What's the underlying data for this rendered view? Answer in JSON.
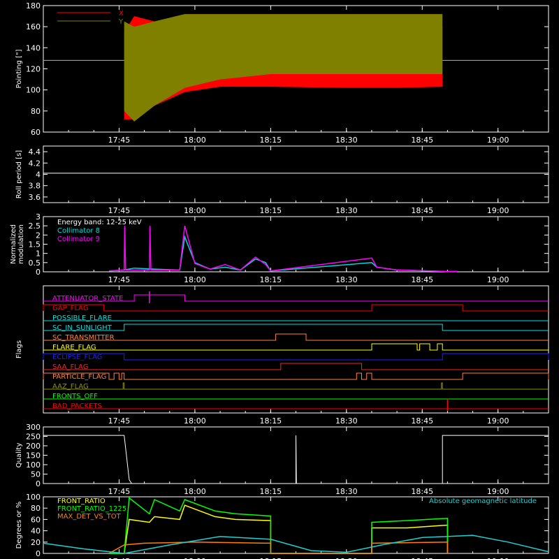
{
  "chart_data": [
    {
      "id": "pointing",
      "type": "area",
      "ylabel": "Pointing [\"]",
      "ylim": [
        60,
        180
      ],
      "yticks": [
        60,
        80,
        100,
        120,
        140,
        160,
        180
      ],
      "xlim": [
        "17:30",
        "19:10"
      ],
      "xticks": [
        "17:45",
        "18:00",
        "18:15",
        "18:30",
        "18:45",
        "19:00"
      ],
      "reference_line": 128,
      "legend": "top-left",
      "series": [
        {
          "name": "X",
          "color": "#ff0000",
          "x": [
            "17:46",
            "17:48",
            "17:52",
            "17:58",
            "18:05",
            "18:15",
            "18:30",
            "18:40",
            "18:49"
          ],
          "upper": [
            155,
            170,
            165,
            168,
            166,
            163,
            160,
            160,
            160
          ],
          "lower": [
            72,
            72,
            85,
            98,
            103,
            103,
            102,
            102,
            103
          ]
        },
        {
          "name": "Y",
          "color": "#808000",
          "x": [
            "17:46",
            "17:48",
            "17:52",
            "17:58",
            "18:05",
            "18:15",
            "18:30",
            "18:40",
            "18:49"
          ],
          "upper": [
            165,
            160,
            165,
            172,
            172,
            172,
            172,
            172,
            172
          ],
          "lower": [
            80,
            70,
            85,
            102,
            110,
            115,
            115,
            115,
            115
          ]
        }
      ]
    },
    {
      "id": "roll",
      "type": "line",
      "ylabel": "Roll period [s]",
      "ylim": [
        3.5,
        4.5
      ],
      "yticks": [
        3.6,
        3.8,
        4.0,
        4.2,
        4.4
      ],
      "xlim": [
        "17:30",
        "19:10"
      ],
      "xticks": [
        "17:45",
        "18:00",
        "18:15",
        "18:30",
        "18:45",
        "19:00"
      ],
      "series": [
        {
          "color": "#ffffff",
          "x": [
            "17:30",
            "19:10"
          ],
          "y": [
            4.02,
            4.02
          ]
        }
      ]
    },
    {
      "id": "modulation",
      "type": "line",
      "ylabel": "Normalized modulation",
      "ylim": [
        0.0,
        3.0
      ],
      "yticks": [
        0.0,
        0.5,
        1.0,
        1.5,
        2.0,
        2.5,
        3.0
      ],
      "xlim": [
        "17:30",
        "19:10"
      ],
      "xticks": [
        "17:45",
        "18:00",
        "18:15",
        "18:30",
        "18:45",
        "19:00"
      ],
      "annotation": "Energy band: 12-25 keV",
      "series": [
        {
          "name": "Collimator 8",
          "color": "#00d8d8",
          "x": [
            "17:43",
            "17:46",
            "17:48",
            "17:52",
            "17:57",
            "17:58",
            "18:00",
            "18:03",
            "18:06",
            "18:09",
            "18:12",
            "18:14",
            "18:15",
            "18:35",
            "18:36",
            "18:40",
            "18:50",
            "18:52"
          ],
          "y": [
            0.05,
            0.1,
            0.2,
            0.15,
            0.1,
            1.9,
            0.5,
            0.15,
            0.25,
            0.1,
            0.7,
            0.5,
            0.05,
            0.5,
            0.25,
            0.1,
            0.02,
            0.02
          ]
        },
        {
          "name": "Collimator 9",
          "color": "#ff00ff",
          "x": [
            "17:43",
            "17:46",
            "17:46.1",
            "17:46.3",
            "17:48",
            "17:50",
            "17:51",
            "17:51.1",
            "17:51.3",
            "17:52",
            "17:57",
            "17:58",
            "18:00",
            "18:03",
            "18:06",
            "18:09",
            "18:12",
            "18:14",
            "18:15",
            "18:35",
            "18:36",
            "18:40",
            "18:50",
            "18:52"
          ],
          "y": [
            0.05,
            0.1,
            2.5,
            0.1,
            0.1,
            0.1,
            0.1,
            2.5,
            0.1,
            0.1,
            0.1,
            2.5,
            0.45,
            0.15,
            0.4,
            0.1,
            0.8,
            0.4,
            0.05,
            0.75,
            0.25,
            0.1,
            0.02,
            0.02
          ]
        }
      ]
    },
    {
      "id": "flags",
      "type": "line",
      "ylabel": "Flags",
      "xlim": [
        "17:30",
        "19:10"
      ],
      "xticks": [
        "17:45",
        "18:00",
        "18:15",
        "18:30",
        "18:45",
        "19:00"
      ],
      "flags": [
        {
          "name": "ATTENUATOR_STATE",
          "color": "#ff00ff",
          "high": [
            [
              "17:48",
              "17:58"
            ]
          ],
          "spike": [
            "17:51"
          ]
        },
        {
          "name": "GAP_FLAG",
          "color": "#ff0000",
          "high": [
            [
              "17:30",
              "17:42"
            ],
            [
              "18:35",
              "18:53"
            ]
          ]
        },
        {
          "name": "POSSIBLE_FLARE",
          "color": "#00e0e0",
          "high": []
        },
        {
          "name": "SC_IN_SUNLIGHT",
          "color": "#00e0e0",
          "high": [
            [
              "17:46",
              "18:49"
            ]
          ]
        },
        {
          "name": "SC_TRANSMITTER",
          "color": "#ff8040",
          "high": [
            [
              "18:16",
              "18:22"
            ]
          ]
        },
        {
          "name": "FLARE_FLAG",
          "color": "#ffff00",
          "high": [
            [
              "18:35",
              "18:44"
            ],
            [
              "18:44.5",
              "18:46.5"
            ],
            [
              "18:48",
              "18:49"
            ]
          ]
        },
        {
          "name": "ECLIPSE_FLAG",
          "color": "#2020ff",
          "high": [
            [
              "17:30",
              "17:46"
            ],
            [
              "18:49",
              "19:10"
            ]
          ]
        },
        {
          "name": "SAA_FLAG",
          "color": "#ff2020",
          "high": [
            [
              "18:17",
              "18:33"
            ]
          ]
        },
        {
          "name": "PARTICLE_FLAG",
          "color": "#ff8040",
          "high": [
            [
              "17:30",
              "17:43"
            ],
            [
              "17:44",
              "17:45"
            ],
            [
              "17:45.5",
              "17:46"
            ],
            [
              "18:32",
              "18:33"
            ],
            [
              "18:34",
              "18:35"
            ],
            [
              "18:53",
              "19:10"
            ]
          ]
        },
        {
          "name": "AAZ_FLAG",
          "color": "#909000",
          "high": [
            [
              "17:45.8",
              "17:46"
            ],
            [
              "18:48.8",
              "18:49"
            ]
          ]
        },
        {
          "name": "FRONTS_OFF",
          "color": "#00ff00",
          "high": []
        },
        {
          "name": "BAD_PACKETS",
          "color": "#ff0000",
          "high": [],
          "spike": [
            "18:50"
          ]
        }
      ]
    },
    {
      "id": "quality",
      "type": "line",
      "ylabel": "Quality",
      "ylim": [
        0,
        300
      ],
      "yticks": [
        0,
        50,
        100,
        150,
        200,
        250,
        300
      ],
      "xlim": [
        "17:30",
        "19:10"
      ],
      "xticks": [
        "17:45",
        "18:00",
        "18:15",
        "18:30",
        "18:45",
        "19:00"
      ],
      "series": [
        {
          "color": "#ffffff",
          "x": [
            "17:30",
            "17:46",
            "17:47",
            "17:47.5",
            "18:20",
            "18:20",
            "18:20.1",
            "18:49",
            "18:49",
            "19:10"
          ],
          "y": [
            255,
            255,
            20,
            0,
            0,
            255,
            0,
            0,
            255,
            255
          ]
        }
      ]
    },
    {
      "id": "ratios",
      "type": "line",
      "ylabel": "Degrees or %",
      "ylim": [
        0,
        100
      ],
      "yticks": [
        0,
        20,
        40,
        60,
        80,
        100
      ],
      "xlim": [
        "17:30",
        "19:10"
      ],
      "xticks": [
        "17:45",
        "18:00",
        "18:15",
        "18:30",
        "18:45",
        "19:00"
      ],
      "series": [
        {
          "name": "FRONT_RATIO",
          "color": "#ffff00",
          "x": [
            "17:43",
            "17:46",
            "17:47",
            "17:51",
            "17:52",
            "17:57",
            "17:58",
            "18:04",
            "18:08",
            "18:15",
            "18:15",
            "18:35",
            "18:35",
            "18:42",
            "18:50",
            "18:50"
          ],
          "y": [
            0,
            0,
            60,
            55,
            65,
            60,
            85,
            65,
            60,
            58,
            0,
            0,
            45,
            45,
            50,
            0
          ]
        },
        {
          "name": "FRONT_RATIO_1225",
          "color": "#00ff00",
          "x": [
            "17:43",
            "17:46",
            "17:47",
            "17:51",
            "17:52",
            "17:57",
            "17:58",
            "18:04",
            "18:08",
            "18:15",
            "18:15",
            "18:35",
            "18:35",
            "18:42",
            "18:50",
            "18:50"
          ],
          "y": [
            0,
            0,
            98,
            70,
            95,
            75,
            95,
            75,
            70,
            66,
            0,
            0,
            55,
            58,
            62,
            0
          ]
        },
        {
          "name": "MAX_DET_VS_TOT",
          "color": "#ff8000",
          "x": [
            "17:43",
            "17:46",
            "17:50",
            "18:00",
            "18:15",
            "18:15",
            "18:35",
            "18:35",
            "18:50",
            "18:50"
          ],
          "y": [
            0,
            15,
            18,
            20,
            18,
            0,
            0,
            18,
            20,
            0
          ]
        },
        {
          "name": "Absolute geomagnetic latitude",
          "color": "#20d0d0",
          "x": [
            "17:30",
            "17:38",
            "17:46",
            "17:55",
            "18:05",
            "18:15",
            "18:23",
            "18:30",
            "18:37",
            "18:45",
            "18:55",
            "19:02",
            "19:10"
          ],
          "y": [
            18,
            8,
            0,
            15,
            30,
            25,
            5,
            2,
            15,
            28,
            32,
            20,
            3
          ]
        }
      ]
    }
  ]
}
